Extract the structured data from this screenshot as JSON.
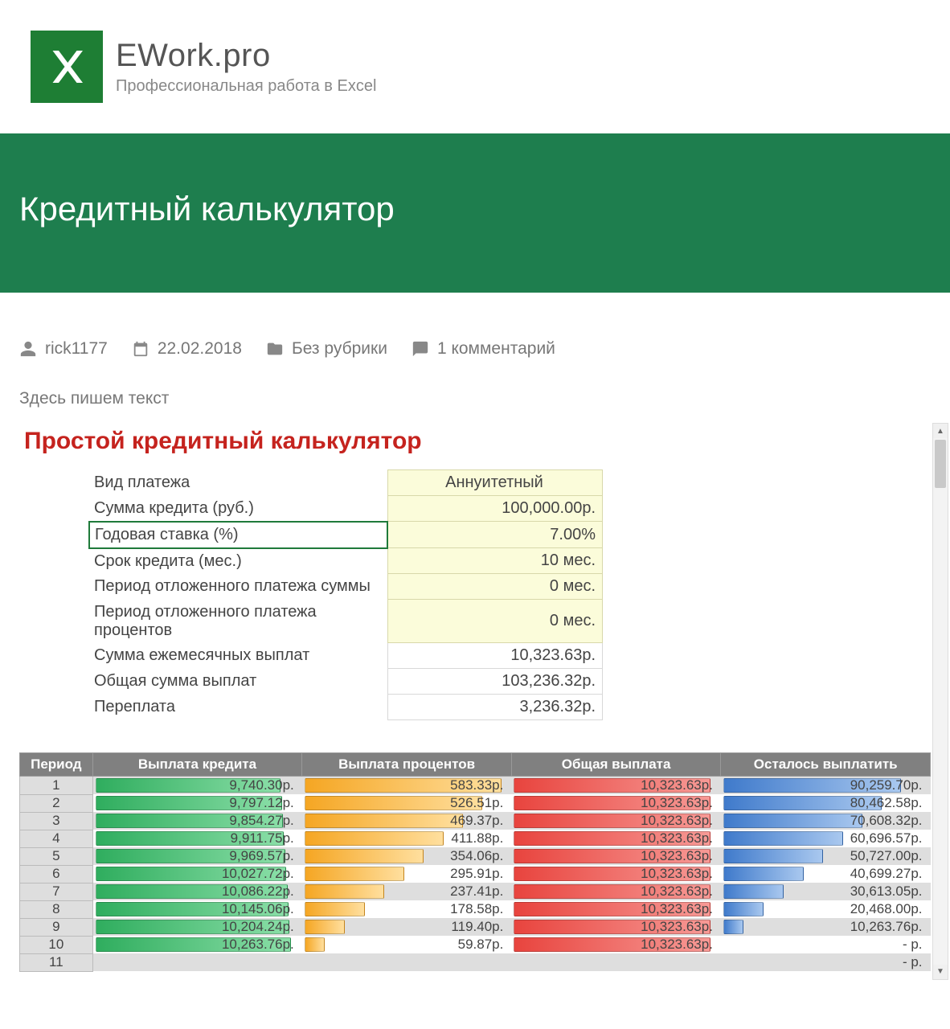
{
  "site": {
    "title": "EWork.pro",
    "tagline": "Профессиональная работа в Excel"
  },
  "page": {
    "title": "Кредитный калькулятор"
  },
  "meta": {
    "author": "rick1177",
    "date": "22.02.2018",
    "category": "Без рубрики",
    "comments": "1 комментарий"
  },
  "body_text": "Здесь пишем текст",
  "calc": {
    "heading": "Простой кредитный калькулятор",
    "params": [
      {
        "label": "Вид платежа",
        "value": "Аннуитетный",
        "type": "in",
        "align": "center"
      },
      {
        "label": "Сумма кредита (руб.)",
        "value": "100,000.00р.",
        "type": "in"
      },
      {
        "label": "Годовая ставка (%)",
        "value": "7.00%",
        "type": "in",
        "selected": true
      },
      {
        "label": "Срок кредита (мес.)",
        "value": "10 мес.",
        "type": "in"
      },
      {
        "label": "Период отложенного платежа суммы",
        "value": "0 мес.",
        "type": "in"
      },
      {
        "label": "Период отложенного платежа процентов",
        "value": "0 мес.",
        "type": "in"
      },
      {
        "label": "Сумма ежемесячных выплат",
        "value": "10,323.63р.",
        "type": "out"
      },
      {
        "label": "Общая сумма выплат",
        "value": "103,236.32р.",
        "type": "out"
      },
      {
        "label": "Переплата",
        "value": "3,236.32р.",
        "type": "out"
      }
    ],
    "columns": [
      "Период",
      "Выплата кредита",
      "Выплата процентов",
      "Общая выплата",
      "Осталось выплатить"
    ],
    "max": {
      "principal": 10323.63,
      "interest": 583.33,
      "total": 10323.63,
      "balance": 100000
    },
    "rows": [
      {
        "period": "1",
        "principal": "9,740.30р.",
        "p": 9740.3,
        "interest": "583.33р.",
        "i": 583.33,
        "total": "10,323.63р.",
        "t": 10323.63,
        "balance": "90,259.70р.",
        "b": 90259.7
      },
      {
        "period": "2",
        "principal": "9,797.12р.",
        "p": 9797.12,
        "interest": "526.51р.",
        "i": 526.51,
        "total": "10,323.63р.",
        "t": 10323.63,
        "balance": "80,462.58р.",
        "b": 80462.58
      },
      {
        "period": "3",
        "principal": "9,854.27р.",
        "p": 9854.27,
        "interest": "469.37р.",
        "i": 469.37,
        "total": "10,323.63р.",
        "t": 10323.63,
        "balance": "70,608.32р.",
        "b": 70608.32
      },
      {
        "period": "4",
        "principal": "9,911.75р.",
        "p": 9911.75,
        "interest": "411.88р.",
        "i": 411.88,
        "total": "10,323.63р.",
        "t": 10323.63,
        "balance": "60,696.57р.",
        "b": 60696.57
      },
      {
        "period": "5",
        "principal": "9,969.57р.",
        "p": 9969.57,
        "interest": "354.06р.",
        "i": 354.06,
        "total": "10,323.63р.",
        "t": 10323.63,
        "balance": "50,727.00р.",
        "b": 50727.0
      },
      {
        "period": "6",
        "principal": "10,027.72р.",
        "p": 10027.72,
        "interest": "295.91р.",
        "i": 295.91,
        "total": "10,323.63р.",
        "t": 10323.63,
        "balance": "40,699.27р.",
        "b": 40699.27
      },
      {
        "period": "7",
        "principal": "10,086.22р.",
        "p": 10086.22,
        "interest": "237.41р.",
        "i": 237.41,
        "total": "10,323.63р.",
        "t": 10323.63,
        "balance": "30,613.05р.",
        "b": 30613.05
      },
      {
        "period": "8",
        "principal": "10,145.06р.",
        "p": 10145.06,
        "interest": "178.58р.",
        "i": 178.58,
        "total": "10,323.63р.",
        "t": 10323.63,
        "balance": "20,468.00р.",
        "b": 20468.0
      },
      {
        "period": "9",
        "principal": "10,204.24р.",
        "p": 10204.24,
        "interest": "119.40р.",
        "i": 119.4,
        "total": "10,323.63р.",
        "t": 10323.63,
        "balance": "10,263.76р.",
        "b": 10263.76
      },
      {
        "period": "10",
        "principal": "10,263.76р.",
        "p": 10263.76,
        "interest": "59.87р.",
        "i": 59.87,
        "total": "10,323.63р.",
        "t": 10323.63,
        "balance": "-   р.",
        "b": 0
      },
      {
        "period": "11",
        "principal": "",
        "p": 0,
        "interest": "",
        "i": 0,
        "total": "",
        "t": 0,
        "balance": "-   р.",
        "b": 0
      }
    ]
  },
  "chart_data": {
    "type": "table",
    "title": "Простой кредитный калькулятор — график погашения",
    "columns": [
      "Период",
      "Выплата кредита (р.)",
      "Выплата процентов (р.)",
      "Общая выплата (р.)",
      "Осталось выплатить (р.)"
    ],
    "rows": [
      [
        1,
        9740.3,
        583.33,
        10323.63,
        90259.7
      ],
      [
        2,
        9797.12,
        526.51,
        10323.63,
        80462.58
      ],
      [
        3,
        9854.27,
        469.37,
        10323.63,
        70608.32
      ],
      [
        4,
        9911.75,
        411.88,
        10323.63,
        60696.57
      ],
      [
        5,
        9969.57,
        354.06,
        10323.63,
        50727.0
      ],
      [
        6,
        10027.72,
        295.91,
        10323.63,
        40699.27
      ],
      [
        7,
        10086.22,
        237.41,
        10323.63,
        30613.05
      ],
      [
        8,
        10145.06,
        178.58,
        10323.63,
        20468.0
      ],
      [
        9,
        10204.24,
        119.4,
        10323.63,
        10263.76
      ],
      [
        10,
        10263.76,
        59.87,
        10323.63,
        0
      ]
    ]
  }
}
